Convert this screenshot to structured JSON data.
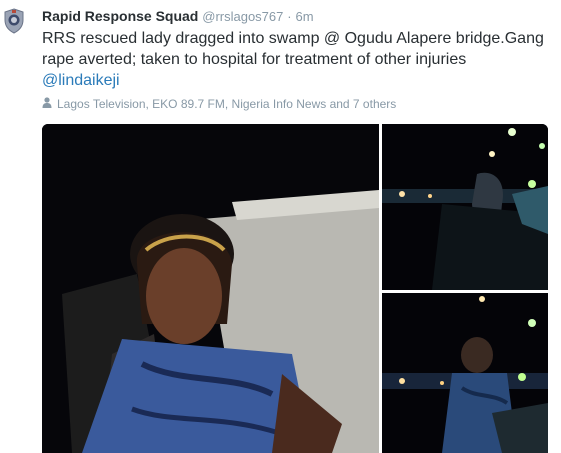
{
  "tweet": {
    "author_name": "Rapid Response Squad",
    "author_handle": "@rrslagos767",
    "separator": "·",
    "time": "6m",
    "text": "RRS rescued lady dragged into swamp @ Ogudu Alapere bridge.Gang rape averted; taken to hospital for treatment of other injuries",
    "mention": "@lindaikeji",
    "context": "Lagos Television, EKO 89.7 FM, Nigeria Info News and 7 others"
  },
  "icons": {
    "avatar": "police-badge-avatar-icon",
    "context": "person-icon"
  },
  "colors": {
    "text": "#292f33",
    "muted": "#8899a6",
    "link": "#2b7bb9"
  }
}
